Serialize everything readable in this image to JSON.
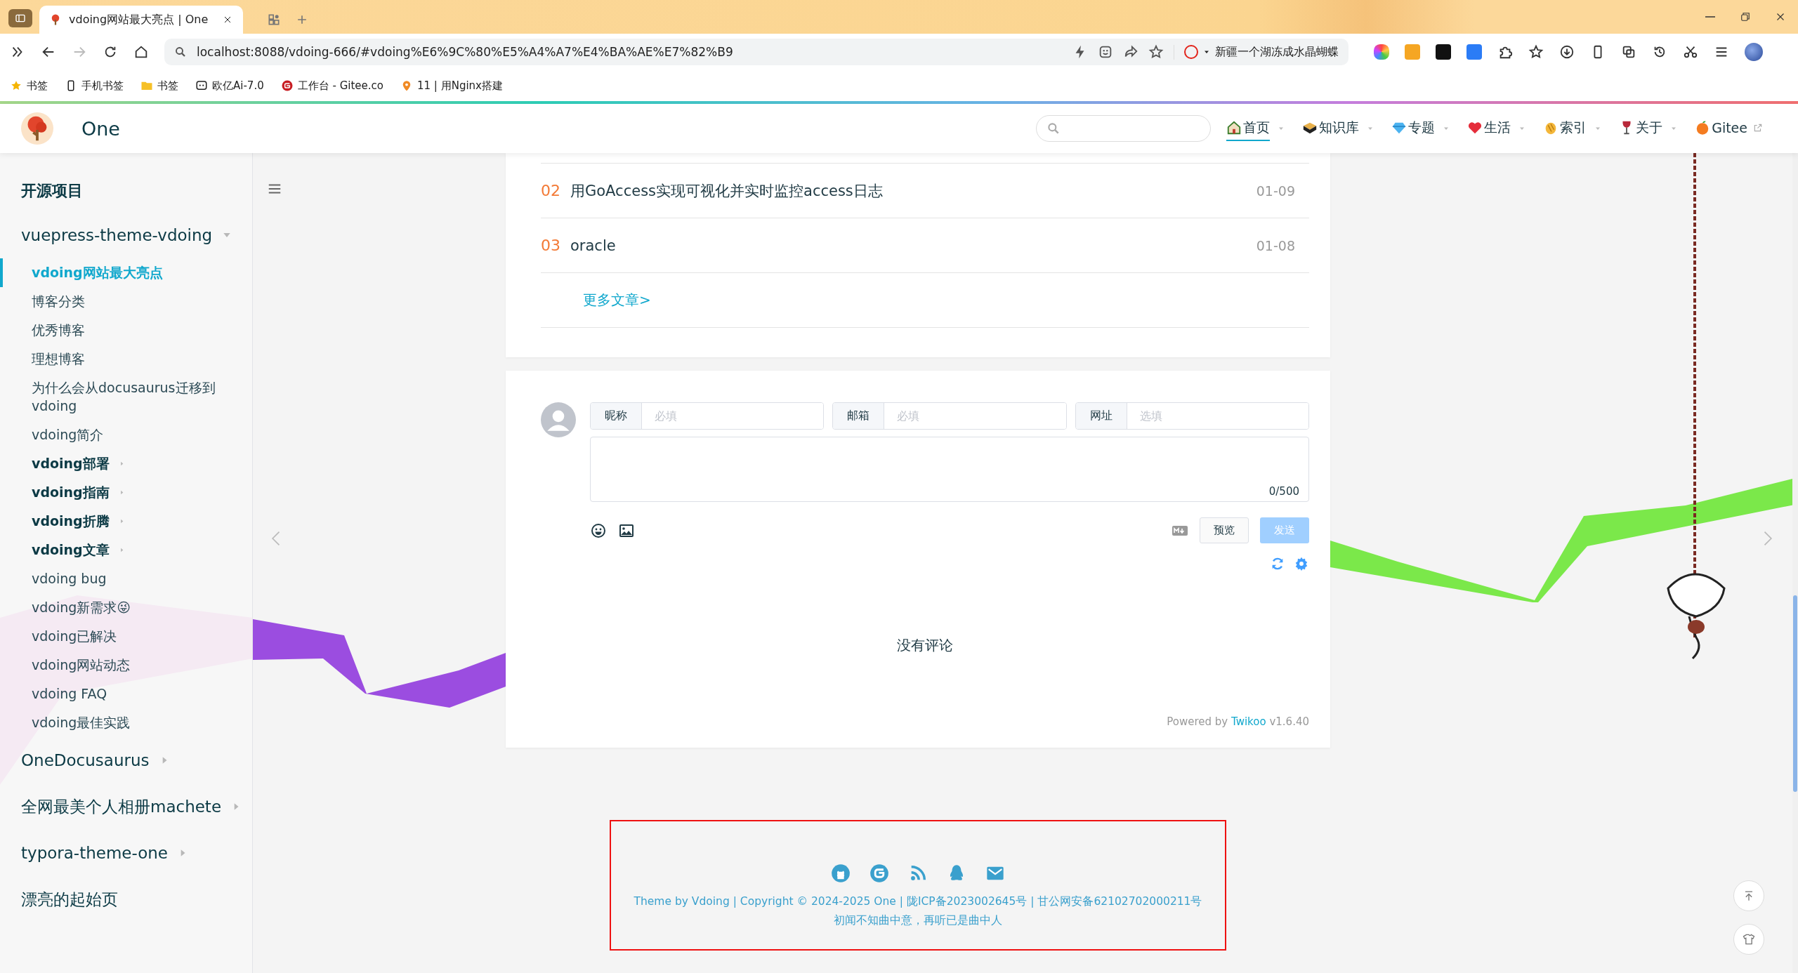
{
  "browser": {
    "tabs": [
      {
        "title": "vdoing网站最大亮点 | One",
        "selected": true
      }
    ],
    "address": "localhost:8088/vdoing-666/#vdoing%E6%9C%80%E5%A4%A7%E4%BA%AE%E7%82%B9",
    "hot_search": "新疆一个湖冻成水晶蝴蝶",
    "bookmarks": [
      {
        "label": "书签",
        "kind": "star"
      },
      {
        "label": "手机书签",
        "kind": "phone"
      },
      {
        "label": "书签",
        "kind": "folder"
      },
      {
        "label": "欧亿Ai-7.0",
        "kind": "bot"
      },
      {
        "label": "工作台 - Gitee.co",
        "kind": "gitee"
      },
      {
        "label": "11 | 用Nginx搭建",
        "kind": "pin"
      }
    ]
  },
  "site": {
    "name": "One",
    "nav": [
      {
        "label": "首页",
        "kind": "home",
        "selected": true,
        "dropdown": true,
        "external": false
      },
      {
        "label": "知识库",
        "kind": "book",
        "selected": false,
        "dropdown": true,
        "external": false
      },
      {
        "label": "专题",
        "kind": "gem",
        "selected": false,
        "dropdown": true,
        "external": false
      },
      {
        "label": "生活",
        "kind": "heart",
        "selected": false,
        "dropdown": true,
        "external": false
      },
      {
        "label": "索引",
        "kind": "hands",
        "selected": false,
        "dropdown": true,
        "external": false
      },
      {
        "label": "关于",
        "kind": "wine",
        "selected": false,
        "dropdown": true,
        "external": false
      },
      {
        "label": "Gitee",
        "kind": "orange",
        "selected": false,
        "dropdown": false,
        "external": true
      }
    ]
  },
  "sidebar": {
    "title": "开源项目",
    "groups": [
      {
        "label": "vuepress-theme-vdoing",
        "kind": "folder",
        "expanded": true,
        "children": [
          {
            "label": "vdoing网站最大亮点",
            "kind": "page",
            "selected": true
          },
          {
            "label": "博客分类",
            "kind": "page",
            "selected": false
          },
          {
            "label": "优秀博客",
            "kind": "page",
            "selected": false
          },
          {
            "label": "理想博客",
            "kind": "page",
            "selected": false
          },
          {
            "label": "为什么会从docusaurus迁移到vdoing",
            "kind": "page",
            "selected": false
          },
          {
            "label": "vdoing简介",
            "kind": "page",
            "selected": false
          },
          {
            "label": "vdoing部署",
            "kind": "folder",
            "selected": false,
            "expanded": false
          },
          {
            "label": "vdoing指南",
            "kind": "folder",
            "selected": false,
            "expanded": false
          },
          {
            "label": "vdoing折腾",
            "kind": "folder",
            "selected": false,
            "expanded": false
          },
          {
            "label": "vdoing文章",
            "kind": "folder",
            "selected": false,
            "expanded": false
          },
          {
            "label": "vdoing bug",
            "kind": "page",
            "selected": false
          },
          {
            "label": "vdoing新需求😜",
            "kind": "page",
            "selected": false
          },
          {
            "label": "vdoing已解决",
            "kind": "page",
            "selected": false
          },
          {
            "label": "vdoing网站动态",
            "kind": "page",
            "selected": false
          },
          {
            "label": "vdoing FAQ",
            "kind": "page",
            "selected": false
          },
          {
            "label": "vdoing最佳实践",
            "kind": "page",
            "selected": false
          }
        ]
      },
      {
        "label": "OneDocusaurus",
        "kind": "folder",
        "expanded": false
      },
      {
        "label": "全网最美个人相册machete",
        "kind": "folder",
        "expanded": false
      },
      {
        "label": "typora-theme-one",
        "kind": "folder",
        "expanded": false
      },
      {
        "label": "漂亮的起始页",
        "kind": "page"
      }
    ]
  },
  "articles": {
    "rows": [
      {
        "number": "02",
        "title": "用GoAccess实现可视化并实时监控access日志",
        "date": "01-09"
      },
      {
        "number": "03",
        "title": "oracle",
        "date": "01-08"
      }
    ],
    "more": "更多文章>"
  },
  "comments": {
    "fields": [
      {
        "label": "昵称",
        "placeholder": "必填"
      },
      {
        "label": "邮箱",
        "placeholder": "必填"
      },
      {
        "label": "网址",
        "placeholder": "选填"
      }
    ],
    "counter": "0/500",
    "preview": "预览",
    "send": {
      "label": "发送",
      "disabled": true
    },
    "empty": "没有评论",
    "powered": {
      "prefix": "Powered by",
      "link": "Twikoo",
      "version": "v1.6.40"
    }
  },
  "footer": {
    "lines": [
      "Theme by Vdoing | Copyright © 2024-2025 One | 陇ICP备2023002645号 | 甘公网安备62102702000211号",
      "初闻不知曲中意，再听已是曲中人"
    ]
  }
}
